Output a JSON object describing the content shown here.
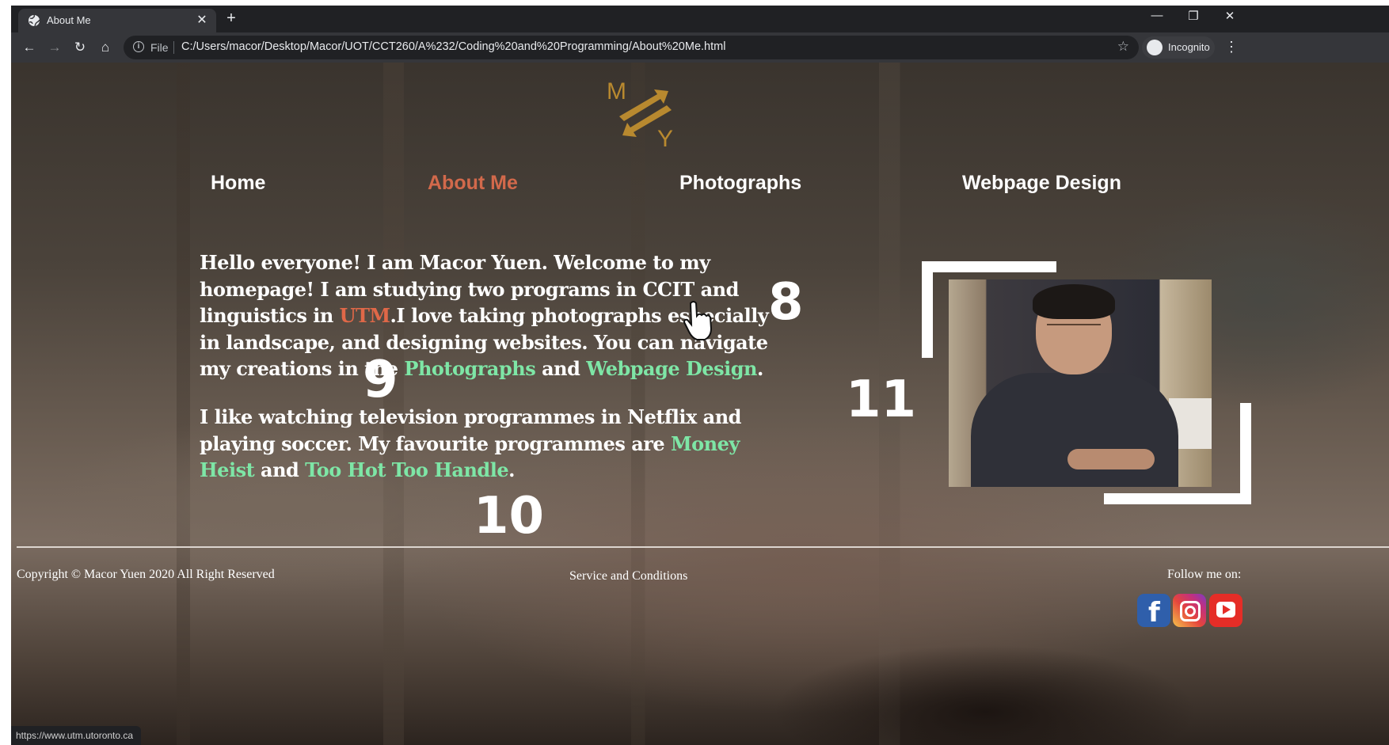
{
  "browser": {
    "tab_title": "About Me",
    "tab_close": "✕",
    "new_tab": "+",
    "window_controls": {
      "minimize": "—",
      "restore": "❐",
      "close": "✕"
    },
    "nav": {
      "back": "←",
      "forward": "→",
      "reload": "↻",
      "home": "⌂"
    },
    "address": {
      "scheme_label": "File",
      "url": "C:/Users/macor/Desktop/Macor/UOT/CCT260/A%232/Coding%20and%20Programming/About%20Me.html"
    },
    "bookmark_icon": "☆",
    "profile_label": "Incognito",
    "menu_icon": "⋮",
    "status_url": "https://www.utm.utoronto.ca"
  },
  "site": {
    "logo": {
      "letter_top": "M",
      "letter_bottom": "Y",
      "color": "#b8892f"
    },
    "nav": [
      "Home",
      "About Me",
      "Photographs",
      "Webpage Design"
    ],
    "active_nav": "About Me",
    "intro": {
      "part1": "Hello everyone! I am Macor Yuen. Welcome to my homepage! I am studying two programs in CCIT and linguistics in ",
      "utm_link": "UTM",
      "part2": ".I love taking photographs especially in landscape, and designing websites. You can navigate my creations in the ",
      "photographs_link": "Photographs",
      "part3": " and ",
      "webdesign_link": "Webpage Design",
      "part4": "."
    },
    "hobbies": {
      "part1": "I like watching television programmes in Netflix and playing soccer. My favourite programmes are ",
      "money_heist_link": "Money Heist",
      "part2": " and ",
      "too_hot_link": "Too Hot Too Handle",
      "part3": "."
    },
    "annotations": [
      "8",
      "9",
      "10",
      "11"
    ],
    "footer": {
      "copyright": "Copyright © Macor Yuen 2020 All Right Reserved",
      "service": "Service and Conditions",
      "follow": "Follow me on:"
    },
    "colors": {
      "active_nav": "#d2694b",
      "link_green": "#7ee6a6",
      "link_red": "#e06848"
    }
  }
}
